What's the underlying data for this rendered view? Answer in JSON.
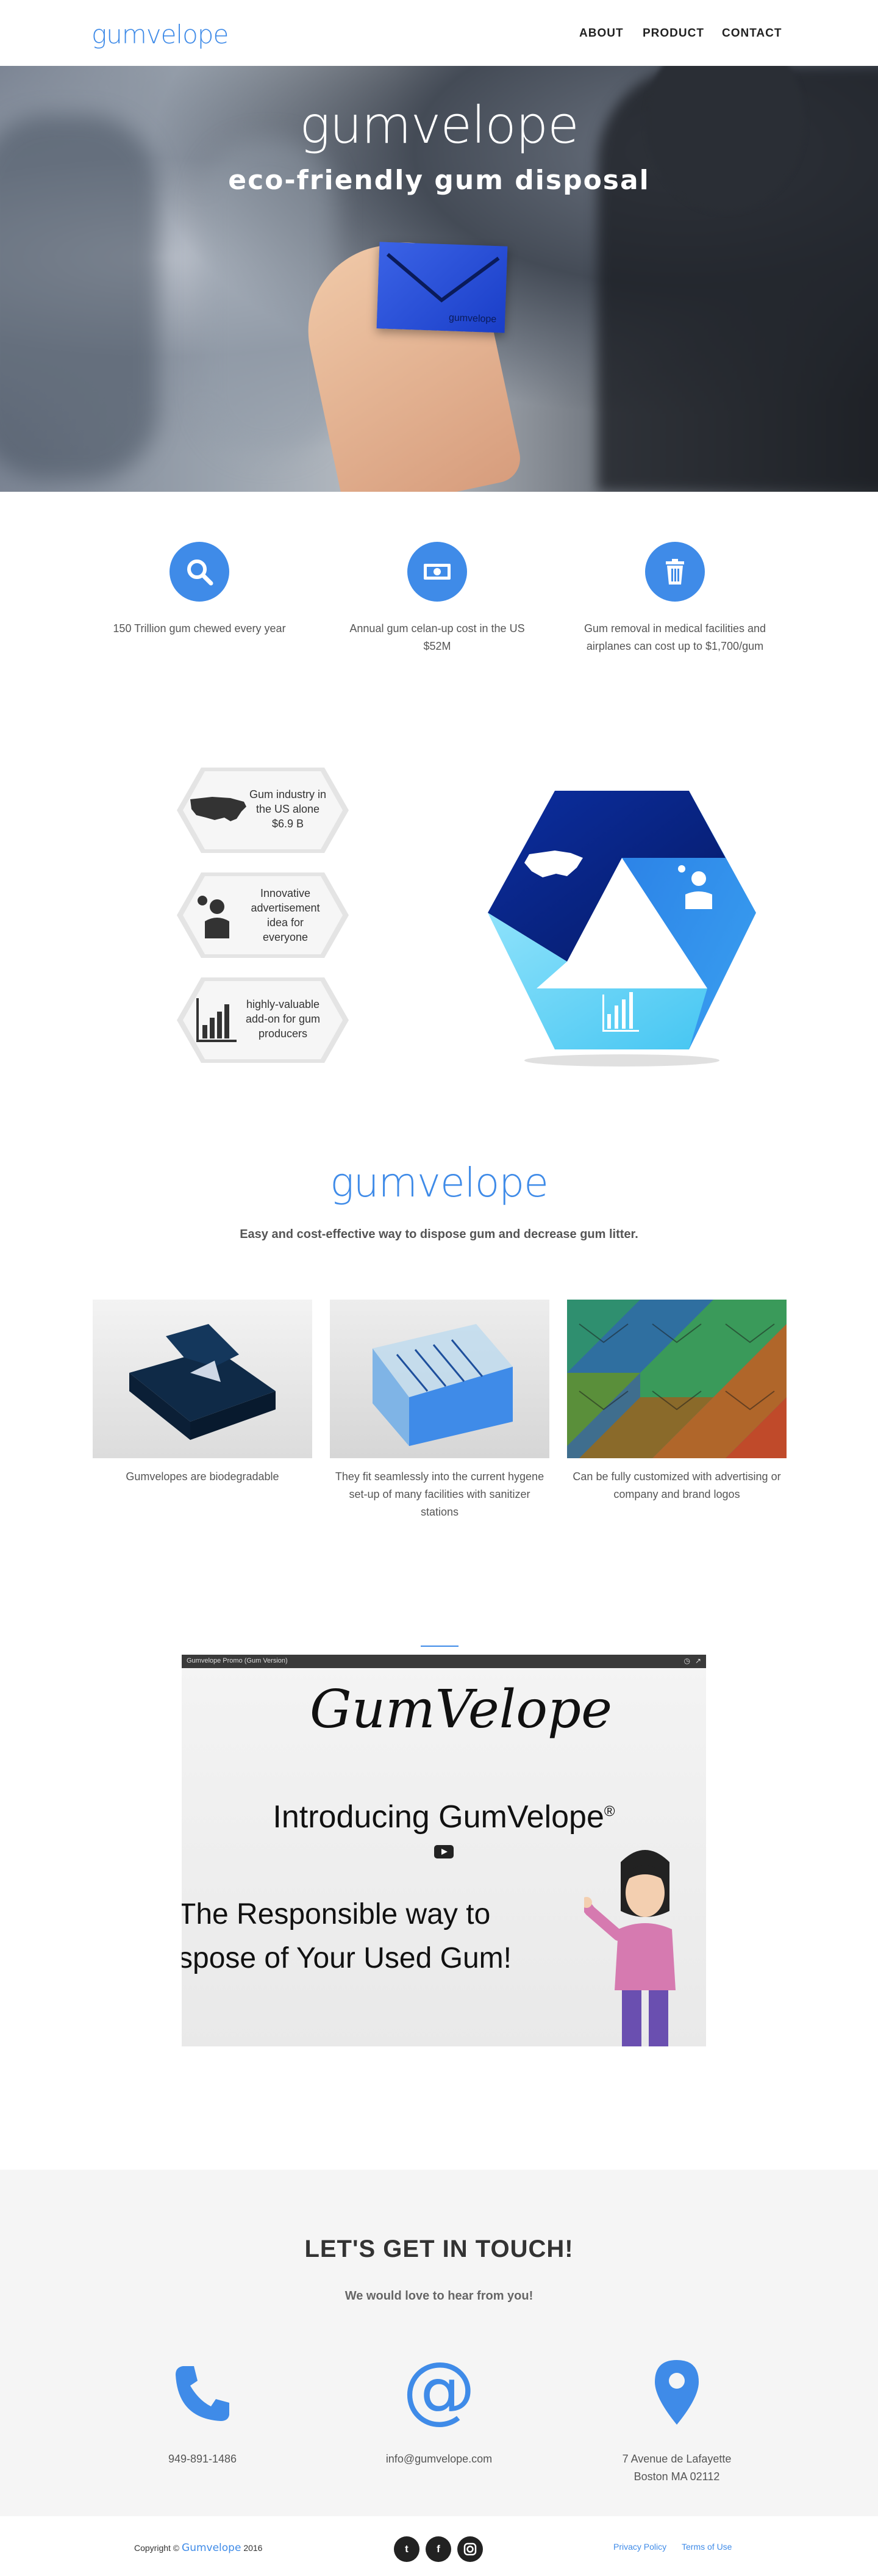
{
  "header": {
    "logo": "gumvelope",
    "nav": [
      "ABOUT",
      "PRODUCT",
      "CONTACT"
    ]
  },
  "hero": {
    "title": "gumvelope",
    "subtitle": "eco-friendly gum disposal",
    "envelope_label": "gumvelope"
  },
  "stats": [
    {
      "icon": "search-icon",
      "text": "150 Trillion gum chewed every year"
    },
    {
      "icon": "money-icon",
      "text": "Annual gum celan-up cost in the US $52M"
    },
    {
      "icon": "trash-icon",
      "text": "Gum removal in medical facilities and airplanes can cost up to $1,700/gum"
    }
  ],
  "features": [
    {
      "icon": "us-map-icon",
      "text": "Gum industry in the US alone $6.9 B"
    },
    {
      "icon": "idea-person-icon",
      "text": "Innovative advertisement idea for everyone"
    },
    {
      "icon": "bar-chart-icon",
      "text": "highly-valuable add-on for gum producers"
    }
  ],
  "product": {
    "logo": "gumvelope",
    "tagline": "Easy and cost-effective way to dispose gum and decrease gum litter.",
    "items": [
      {
        "caption": "Gumvelopes are biodegradable"
      },
      {
        "caption": "They fit seamlessly into the current hygene set-up of many facilities with sanitizer stations"
      },
      {
        "caption": "Can be fully customized with advertising or company and brand logos"
      }
    ]
  },
  "video": {
    "bar_title": "Gumvelope Promo (Gum Version)",
    "brand_script": "GumVelope",
    "heading": "Introducing GumVelope",
    "registered": "®",
    "line1": "The Responsible way to",
    "line2": "spose of Your Used Gum!"
  },
  "contact": {
    "title": "LET'S GET IN TOUCH!",
    "subtitle": "We would love to hear from you!",
    "phone": "949-891-1486",
    "email": "info@gumvelope.com",
    "address_line1": "7 Avenue de Lafayette",
    "address_line2": "Boston MA 02112"
  },
  "footer": {
    "copyright_prefix": "Copyright ©",
    "brand": "Gumvelope",
    "year": "2016",
    "privacy": "Privacy Policy",
    "terms": "Terms of Use",
    "social": [
      "twitter-icon",
      "facebook-icon",
      "instagram-icon"
    ]
  },
  "colors": {
    "accent": "#3f8be8",
    "dark_blue": "#0a2f8f",
    "light_blue": "#5fd0f5",
    "contact_bg": "#f5f5f5"
  }
}
